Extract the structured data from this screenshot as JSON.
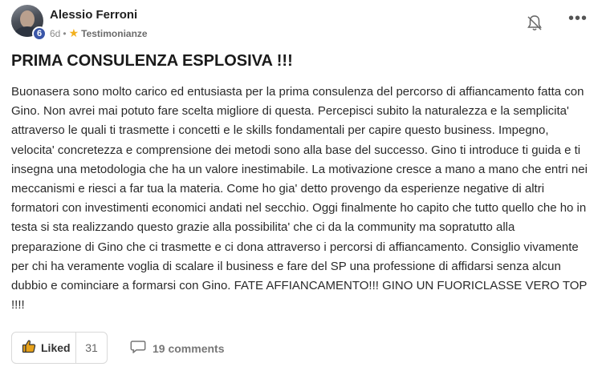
{
  "post": {
    "author": "Alessio Ferroni",
    "level": "6",
    "time": "6d",
    "separator": "•",
    "category": "Testimonianze",
    "category_icon": "star-icon",
    "title": "PRIMA CONSULENZA ESPLOSIVA !!!",
    "body": "Buonasera sono molto carico ed entusiasta per la prima consulenza del percorso di affiancamento fatta con Gino. Non avrei mai potuto fare scelta migliore di questa. Percepisci subito la naturalezza e la semplicita' attraverso le quali ti trasmette i concetti e le skills fondamentali per capire questo business. Impegno, velocita' concretezza e comprensione dei metodi sono alla base del successo. Gino ti introduce ti guida e ti insegna una metodologia che ha un valore inestimabile. La motivazione cresce a mano a mano che entri nei meccanismi e riesci a far tua la materia. Come ho gia' detto provengo da esperienze negative di altri formatori con investimenti economici andati nel secchio. Oggi finalmente ho capito che tutto quello che ho in testa si sta realizzando questo grazie alla possibilita' che ci da la community ma sopratutto alla preparazione di Gino che ci trasmette e ci dona attraverso i percorsi di affiancamento. Consiglio vivamente per chi ha veramente voglia di scalare il business e fare del SP una professione di affidarsi senza alcun dubbio e cominciare a formarsi con Gino. FATE AFFIANCAMENTO!!! GINO UN FUORICLASSE VERO TOP !!!!"
  },
  "actions": {
    "like_label": "Liked",
    "like_count": "31",
    "comments_label": "19 comments"
  },
  "colors": {
    "level_badge": "#3a56a8",
    "star": "#f2b01e",
    "like_icon": "#e8a21a"
  }
}
